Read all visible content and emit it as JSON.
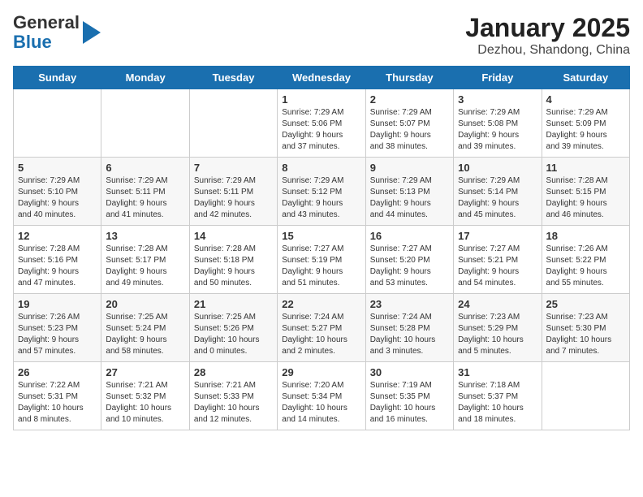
{
  "header": {
    "logo_line1": "General",
    "logo_line2": "Blue",
    "title": "January 2025",
    "subtitle": "Dezhou, Shandong, China"
  },
  "days_of_week": [
    "Sunday",
    "Monday",
    "Tuesday",
    "Wednesday",
    "Thursday",
    "Friday",
    "Saturday"
  ],
  "weeks": [
    [
      {
        "day": "",
        "info": ""
      },
      {
        "day": "",
        "info": ""
      },
      {
        "day": "",
        "info": ""
      },
      {
        "day": "1",
        "info": "Sunrise: 7:29 AM\nSunset: 5:06 PM\nDaylight: 9 hours\nand 37 minutes."
      },
      {
        "day": "2",
        "info": "Sunrise: 7:29 AM\nSunset: 5:07 PM\nDaylight: 9 hours\nand 38 minutes."
      },
      {
        "day": "3",
        "info": "Sunrise: 7:29 AM\nSunset: 5:08 PM\nDaylight: 9 hours\nand 39 minutes."
      },
      {
        "day": "4",
        "info": "Sunrise: 7:29 AM\nSunset: 5:09 PM\nDaylight: 9 hours\nand 39 minutes."
      }
    ],
    [
      {
        "day": "5",
        "info": "Sunrise: 7:29 AM\nSunset: 5:10 PM\nDaylight: 9 hours\nand 40 minutes."
      },
      {
        "day": "6",
        "info": "Sunrise: 7:29 AM\nSunset: 5:11 PM\nDaylight: 9 hours\nand 41 minutes."
      },
      {
        "day": "7",
        "info": "Sunrise: 7:29 AM\nSunset: 5:11 PM\nDaylight: 9 hours\nand 42 minutes."
      },
      {
        "day": "8",
        "info": "Sunrise: 7:29 AM\nSunset: 5:12 PM\nDaylight: 9 hours\nand 43 minutes."
      },
      {
        "day": "9",
        "info": "Sunrise: 7:29 AM\nSunset: 5:13 PM\nDaylight: 9 hours\nand 44 minutes."
      },
      {
        "day": "10",
        "info": "Sunrise: 7:29 AM\nSunset: 5:14 PM\nDaylight: 9 hours\nand 45 minutes."
      },
      {
        "day": "11",
        "info": "Sunrise: 7:28 AM\nSunset: 5:15 PM\nDaylight: 9 hours\nand 46 minutes."
      }
    ],
    [
      {
        "day": "12",
        "info": "Sunrise: 7:28 AM\nSunset: 5:16 PM\nDaylight: 9 hours\nand 47 minutes."
      },
      {
        "day": "13",
        "info": "Sunrise: 7:28 AM\nSunset: 5:17 PM\nDaylight: 9 hours\nand 49 minutes."
      },
      {
        "day": "14",
        "info": "Sunrise: 7:28 AM\nSunset: 5:18 PM\nDaylight: 9 hours\nand 50 minutes."
      },
      {
        "day": "15",
        "info": "Sunrise: 7:27 AM\nSunset: 5:19 PM\nDaylight: 9 hours\nand 51 minutes."
      },
      {
        "day": "16",
        "info": "Sunrise: 7:27 AM\nSunset: 5:20 PM\nDaylight: 9 hours\nand 53 minutes."
      },
      {
        "day": "17",
        "info": "Sunrise: 7:27 AM\nSunset: 5:21 PM\nDaylight: 9 hours\nand 54 minutes."
      },
      {
        "day": "18",
        "info": "Sunrise: 7:26 AM\nSunset: 5:22 PM\nDaylight: 9 hours\nand 55 minutes."
      }
    ],
    [
      {
        "day": "19",
        "info": "Sunrise: 7:26 AM\nSunset: 5:23 PM\nDaylight: 9 hours\nand 57 minutes."
      },
      {
        "day": "20",
        "info": "Sunrise: 7:25 AM\nSunset: 5:24 PM\nDaylight: 9 hours\nand 58 minutes."
      },
      {
        "day": "21",
        "info": "Sunrise: 7:25 AM\nSunset: 5:26 PM\nDaylight: 10 hours\nand 0 minutes."
      },
      {
        "day": "22",
        "info": "Sunrise: 7:24 AM\nSunset: 5:27 PM\nDaylight: 10 hours\nand 2 minutes."
      },
      {
        "day": "23",
        "info": "Sunrise: 7:24 AM\nSunset: 5:28 PM\nDaylight: 10 hours\nand 3 minutes."
      },
      {
        "day": "24",
        "info": "Sunrise: 7:23 AM\nSunset: 5:29 PM\nDaylight: 10 hours\nand 5 minutes."
      },
      {
        "day": "25",
        "info": "Sunrise: 7:23 AM\nSunset: 5:30 PM\nDaylight: 10 hours\nand 7 minutes."
      }
    ],
    [
      {
        "day": "26",
        "info": "Sunrise: 7:22 AM\nSunset: 5:31 PM\nDaylight: 10 hours\nand 8 minutes."
      },
      {
        "day": "27",
        "info": "Sunrise: 7:21 AM\nSunset: 5:32 PM\nDaylight: 10 hours\nand 10 minutes."
      },
      {
        "day": "28",
        "info": "Sunrise: 7:21 AM\nSunset: 5:33 PM\nDaylight: 10 hours\nand 12 minutes."
      },
      {
        "day": "29",
        "info": "Sunrise: 7:20 AM\nSunset: 5:34 PM\nDaylight: 10 hours\nand 14 minutes."
      },
      {
        "day": "30",
        "info": "Sunrise: 7:19 AM\nSunset: 5:35 PM\nDaylight: 10 hours\nand 16 minutes."
      },
      {
        "day": "31",
        "info": "Sunrise: 7:18 AM\nSunset: 5:37 PM\nDaylight: 10 hours\nand 18 minutes."
      },
      {
        "day": "",
        "info": ""
      }
    ]
  ]
}
